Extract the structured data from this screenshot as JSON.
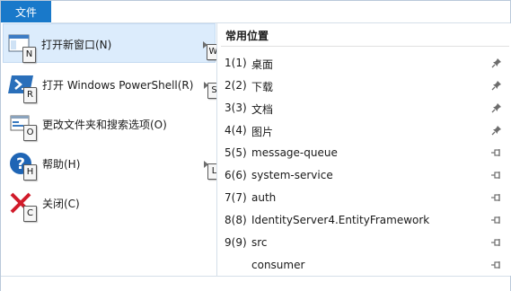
{
  "file_tab": {
    "label": "文件"
  },
  "menu": {
    "items": [
      {
        "label": "打开新窗口(N)",
        "keytip": "N",
        "submenu_keytip": "W",
        "icon": "new-window-icon",
        "selected": true
      },
      {
        "label": "打开 Windows PowerShell(R)",
        "keytip": "R",
        "submenu_keytip": "S",
        "icon": "powershell-icon",
        "selected": false
      },
      {
        "label": "更改文件夹和搜索选项(O)",
        "keytip": "O",
        "submenu_keytip": "",
        "icon": "folder-options-icon",
        "selected": false
      },
      {
        "label": "帮助(H)",
        "keytip": "H",
        "submenu_keytip": "L",
        "icon": "help-icon",
        "selected": false
      },
      {
        "label": "关闭(C)",
        "keytip": "C",
        "submenu_keytip": "",
        "icon": "close-icon",
        "selected": false
      }
    ]
  },
  "recent": {
    "header": "常用位置",
    "items": [
      {
        "num": "1(1)",
        "name": "桌面",
        "pinned": true
      },
      {
        "num": "2(2)",
        "name": "下载",
        "pinned": true
      },
      {
        "num": "3(3)",
        "name": "文档",
        "pinned": true
      },
      {
        "num": "4(4)",
        "name": "图片",
        "pinned": true
      },
      {
        "num": "5(5)",
        "name": "message-queue",
        "pinned": false
      },
      {
        "num": "6(6)",
        "name": "system-service",
        "pinned": false
      },
      {
        "num": "7(7)",
        "name": "auth",
        "pinned": false
      },
      {
        "num": "8(8)",
        "name": "IdentityServer4.EntityFramework",
        "pinned": false
      },
      {
        "num": "9(9)",
        "name": "src",
        "pinned": false
      },
      {
        "num": "",
        "name": "consumer",
        "pinned": false
      }
    ]
  },
  "colors": {
    "accent": "#1979ca",
    "selection": "#dcecfc",
    "divider": "#d5dfe9"
  }
}
